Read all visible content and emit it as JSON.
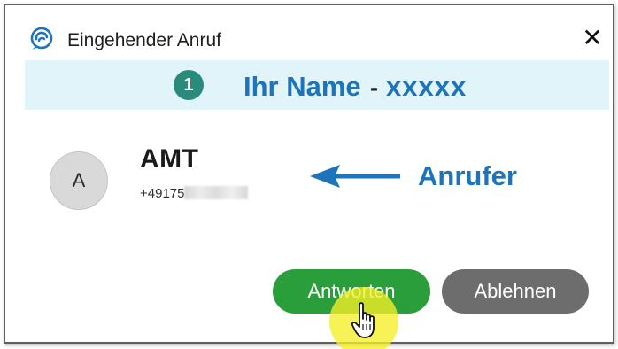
{
  "dialog": {
    "title": "Eingehender Anruf",
    "close_label": "✕",
    "app_icon": "chat-bubble-icon"
  },
  "banner": {
    "step_number": "1",
    "label": "Ihr Name",
    "separator": "-",
    "value": "xxxxx"
  },
  "caller": {
    "avatar_initial": "A",
    "name": "AMT",
    "number_visible": "+49175",
    "number_hidden": "2620676"
  },
  "annotation": {
    "label": "Anrufer",
    "icon": "arrow-left-icon"
  },
  "actions": {
    "answer_label": "Antworten",
    "decline_label": "Ablehnen"
  },
  "pointer": {
    "icon": "hand-pointer-icon"
  },
  "colors": {
    "accent_blue": "#1e74ba",
    "banner_bg": "#e1f4f9",
    "step_badge": "#2a8b7c",
    "answer_green": "#2a9e3a",
    "decline_gray": "#6d6d6d",
    "highlight_yellow": "#f5f028"
  }
}
